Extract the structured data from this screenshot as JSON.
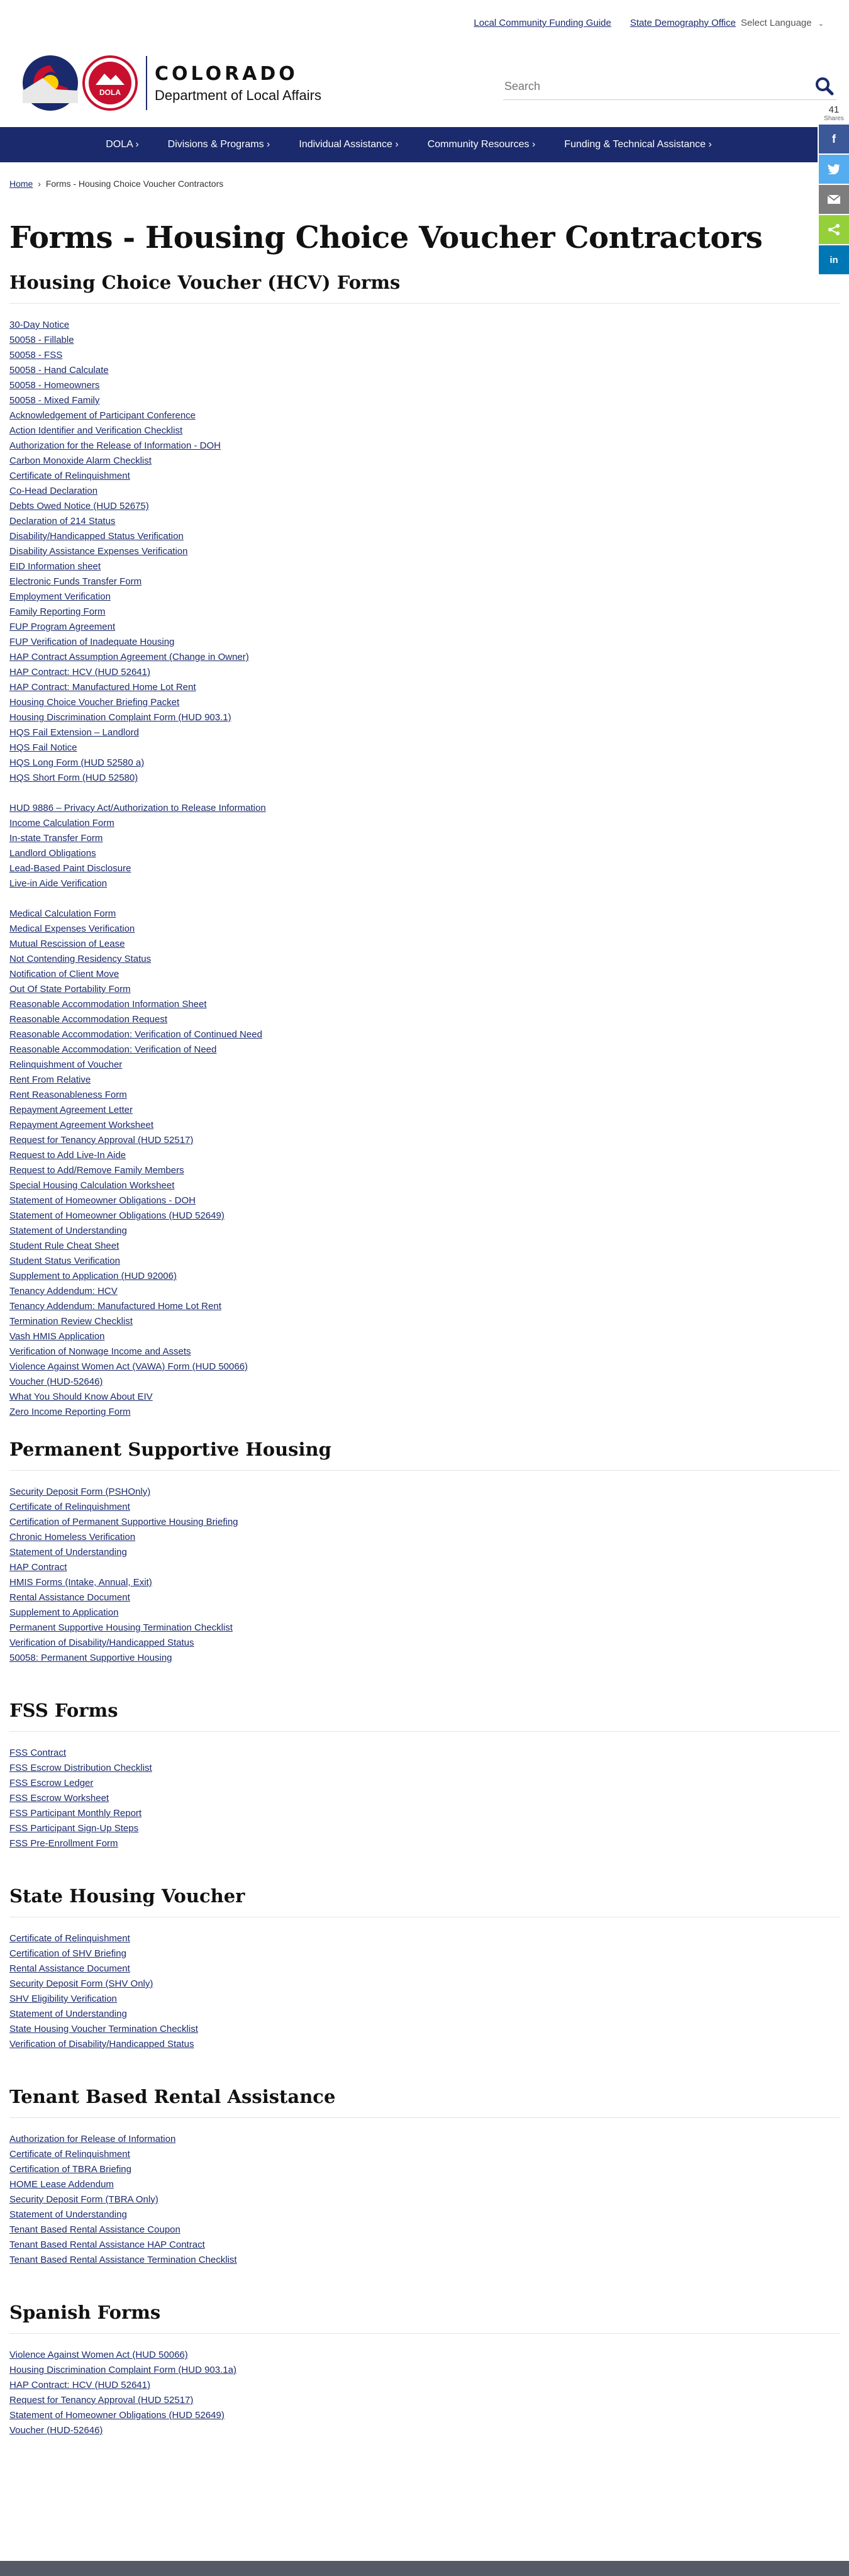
{
  "utility": {
    "links": [
      "Local Community Funding Guide",
      "State Demography Office"
    ],
    "language": "Select Language"
  },
  "header": {
    "logo_line1": "COLORADO",
    "logo_line2": "Department of Local Affairs",
    "seal_text": "DOLA",
    "search_placeholder": "Search"
  },
  "nav": [
    "DOLA",
    "Divisions & Programs",
    "Individual Assistance",
    "Community Resources",
    "Funding & Technical Assistance"
  ],
  "share": {
    "count": "41",
    "label": "Shares"
  },
  "breadcrumb": {
    "home": "Home",
    "current": "Forms - Housing Choice Voucher Contractors"
  },
  "page_title": "Forms - Housing Choice Voucher Contractors",
  "hcv": {
    "title": "Housing Choice Voucher (HCV) Forms",
    "group1": [
      "30-Day Notice",
      "50058 - Fillable",
      "50058 - FSS",
      "50058 - Hand Calculate",
      "50058 - Homeowners",
      "50058 - Mixed Family",
      "Acknowledgement of Participant Conference",
      "Action Identifier and Verification Checklist",
      "Authorization for the Release of Information - DOH",
      "Carbon Monoxide Alarm Checklist",
      "Certificate of Relinquishment",
      "Co-Head Declaration",
      "Debts Owed Notice (HUD 52675)",
      "Declaration of 214 Status",
      "Disability/Handicapped Status Verification",
      "Disability Assistance Expenses Verification",
      "EID Information sheet",
      "Electronic Funds Transfer Form",
      "Employment Verification",
      "Family Reporting Form",
      "FUP Program Agreement",
      "FUP Verification of Inadequate Housing",
      "HAP Contract Assumption Agreement (Change in Owner)",
      "HAP Contract: HCV (HUD 52641)",
      "HAP Contract: Manufactured Home Lot Rent",
      "Housing Choice Voucher Briefing Packet",
      "Housing Discrimination Complaint Form (HUD 903.1)",
      "HQS Fail Extension – Landlord",
      "HQS Fail Notice",
      "HQS Long Form (HUD 52580 a)",
      "HQS Short Form (HUD 52580)"
    ],
    "group2": [
      "HUD 9886 – Privacy Act/Authorization to Release Information",
      "Income Calculation Form",
      "In-state Transfer Form",
      "Landlord Obligations",
      "Lead-Based Paint Disclosure",
      "Live-in Aide Verification"
    ],
    "group3": [
      "Medical Calculation Form",
      "Medical Expenses Verification",
      "Mutual Rescission of Lease",
      "Not Contending Residency Status",
      "Notification of Client Move",
      "Out Of State Portability Form",
      "Reasonable Accommodation Information Sheet",
      "Reasonable Accommodation Request",
      "Reasonable Accommodation: Verification of Continued Need",
      "Reasonable Accommodation: Verification of Need",
      "Relinquishment of Voucher",
      "Rent From Relative",
      "Rent Reasonableness Form",
      "Repayment Agreement Letter",
      "Repayment Agreement Worksheet",
      "Request for Tenancy Approval (HUD 52517)",
      "Request to Add Live-In Aide",
      "Request to Add/Remove Family Members",
      "Special Housing Calculation Worksheet",
      "Statement of Homeowner Obligations - DOH",
      "Statement of Homeowner Obligations (HUD 52649)",
      "Statement of Understanding",
      "Student Rule Cheat Sheet",
      "Student Status Verification",
      "Supplement to Application (HUD 92006)",
      "Tenancy Addendum: HCV",
      "Tenancy Addendum: Manufactured Home Lot Rent",
      "Termination Review Checklist",
      "Vash HMIS Application",
      "Verification of Nonwage Income and Assets",
      "Violence Against Women Act (VAWA) Form (HUD 50066)",
      "Voucher (HUD-52646)",
      "What You Should Know About EIV",
      "Zero Income Reporting Form"
    ]
  },
  "psh": {
    "title": "Permanent Supportive Housing",
    "items": [
      "Security Deposit Form (PSHOnly)",
      "Certificate of Relinquishment",
      "Certification of Permanent Supportive Housing Briefing",
      "Chronic Homeless Verification",
      "Statement of Understanding",
      "HAP Contract",
      "HMIS Forms (Intake, Annual, Exit)",
      "Rental Assistance Document",
      "Supplement to Application",
      "Permanent Supportive Housing Termination Checklist",
      "Verification of Disability/Handicapped Status",
      "50058: Permanent Supportive Housing"
    ]
  },
  "fss": {
    "title": "FSS Forms",
    "items": [
      "FSS Contract",
      "FSS Escrow Distribution Checklist",
      "FSS Escrow Ledger",
      "FSS Escrow Worksheet",
      "FSS Participant Monthly Report",
      "FSS Participant Sign-Up Steps",
      "FSS Pre-Enrollment Form"
    ]
  },
  "shv": {
    "title": "State Housing Voucher",
    "items": [
      "Certificate of Relinquishment",
      "Certification of SHV Briefing",
      "Rental Assistance Document",
      "Security Deposit Form (SHV Only)",
      "SHV Eligibility Verification",
      "Statement of Understanding",
      "State Housing Voucher Termination Checklist",
      "Verification of Disability/Handicapped Status"
    ]
  },
  "tbra": {
    "title": "Tenant Based Rental Assistance",
    "items": [
      "Authorization for Release of Information",
      "Certificate of Relinquishment",
      "Certification of TBRA Briefing",
      "HOME Lease Addendum",
      "Security Deposit Form (TBRA Only)",
      "Statement of Understanding",
      "Tenant Based Rental Assistance Coupon",
      "Tenant Based Rental Assistance HAP Contract",
      "Tenant Based Rental Assistance Termination Checklist"
    ]
  },
  "spanish": {
    "title": "Spanish Forms",
    "items": [
      "Violence Against Women Act (HUD 50066)",
      "Housing Discrimination Complaint Form (HUD 903.1a)",
      "HAP Contract: HCV (HUD 52641)",
      "Request for Tenancy Approval (HUD 52517)",
      "Statement of Homeowner Obligations (HUD 52649)",
      "Voucher (HUD-52646)"
    ]
  },
  "colors": {
    "navy": "#1a2a6c",
    "colorado_red": "#c8102e",
    "colorado_gold": "#ffcd00",
    "facebook": "#3b5998",
    "twitter": "#55acee",
    "email": "#7d7d7d",
    "sharethis": "#95d03a",
    "linkedin": "#0077b5"
  }
}
